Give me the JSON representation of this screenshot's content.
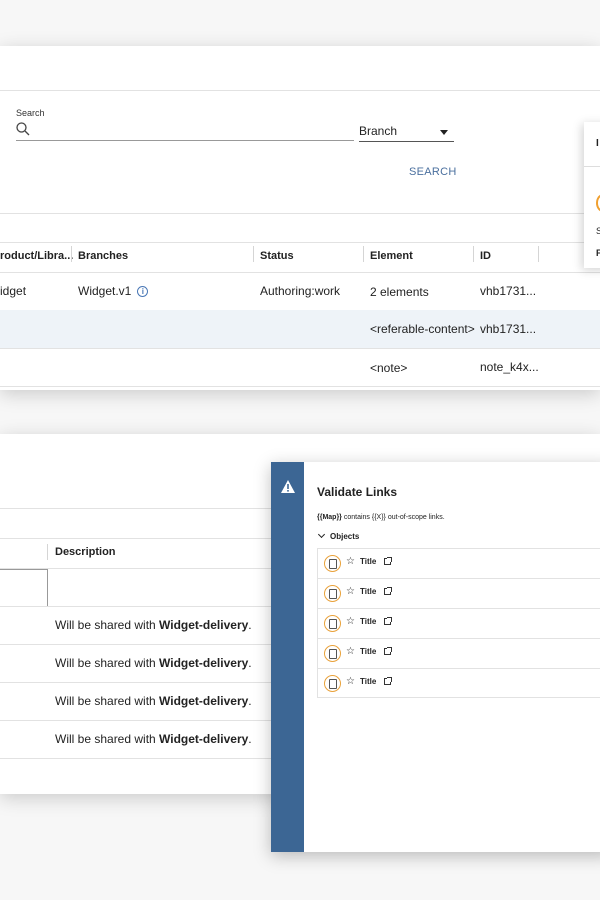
{
  "search": {
    "label": "Search",
    "value": "",
    "branch_value": "Branch",
    "button_label": "SEARCH"
  },
  "table": {
    "headers": [
      "roduct/Libra...",
      "Branches",
      "Status",
      "Element",
      "ID"
    ],
    "rows": [
      [
        "idget",
        "Widget.v1",
        "Authoring:work",
        "2 elements",
        "vhb1731..."
      ],
      [
        "",
        "",
        "",
        "<referable-content>",
        "vhb1731..."
      ],
      [
        "",
        "",
        "",
        "<note>",
        "note_k4x..."
      ]
    ]
  },
  "side_card": {
    "chars": [
      "I",
      "S",
      "F"
    ]
  },
  "share_table": {
    "description_header": "Description",
    "rows": [
      {
        "prefix": "Will be shared with ",
        "target": "Widget-delivery",
        "suffix": "."
      },
      {
        "prefix": "Will be shared with ",
        "target": "Widget-delivery",
        "suffix": "."
      },
      {
        "prefix": "Will be shared with ",
        "target": "Widget-delivery",
        "suffix": "."
      },
      {
        "prefix": "Will be shared with ",
        "target": "Widget-delivery",
        "suffix": "."
      }
    ]
  },
  "dialog": {
    "title": "Validate Links",
    "message_map": "{{Map}}",
    "message_rest": " contains {{X}} out-of-scope links.",
    "objects_label": "Objects",
    "objects": [
      {
        "title": "Title",
        "icon": "document-icon"
      },
      {
        "title": "Title",
        "icon": "document-icon"
      },
      {
        "title": "Title",
        "icon": "document-icon"
      },
      {
        "title": "Title",
        "icon": "document-icon"
      },
      {
        "title": "Title",
        "icon": "document-icon"
      }
    ],
    "colors": {
      "sidebar": "#3c6694",
      "badge": "#e9a23b"
    }
  }
}
